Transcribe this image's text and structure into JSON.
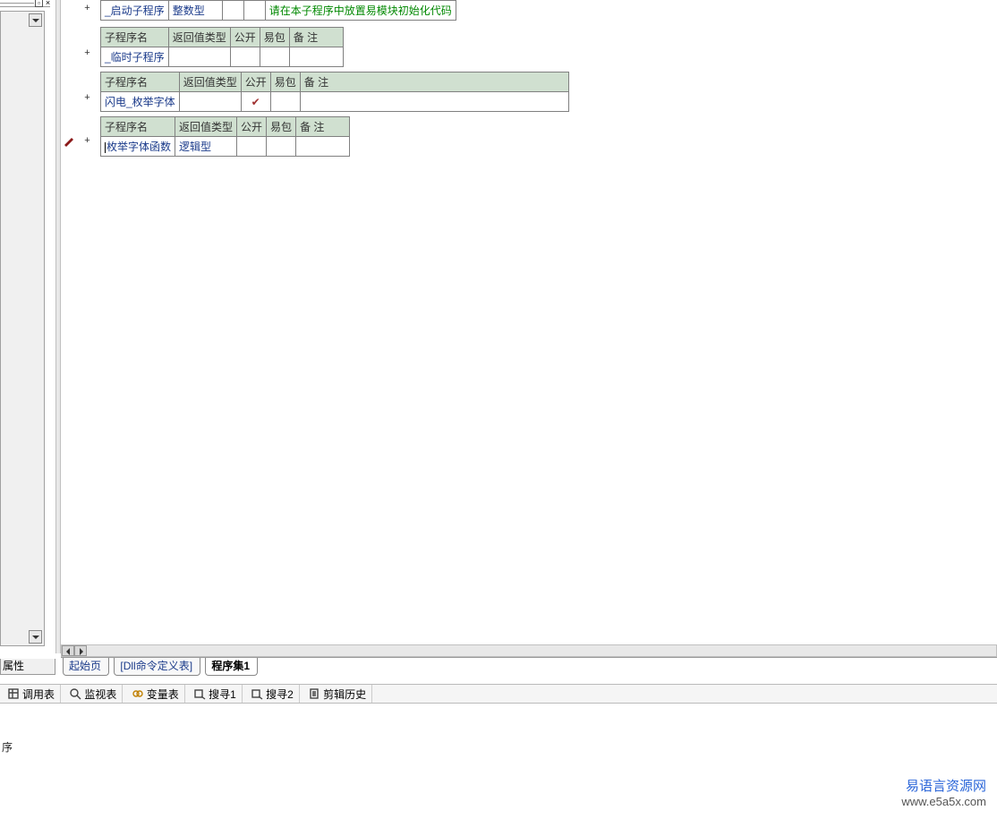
{
  "left_panel": {
    "pin_title": "pin",
    "close_title": "close"
  },
  "tables": {
    "t1": {
      "row": {
        "name": "_启动子程序",
        "ret": "整数型",
        "pub": "",
        "pkg": "",
        "comment": "请在本子程序中放置易模块初始化代码"
      }
    },
    "t2": {
      "head": {
        "c1": "子程序名",
        "c2": "返回值类型",
        "c3": "公开",
        "c4": "易包",
        "c5": "备 注"
      },
      "row": {
        "name": "_临时子程序",
        "ret": "",
        "pub": "",
        "pkg": "",
        "comment": ""
      }
    },
    "t3": {
      "head": {
        "c1": "子程序名",
        "c2": "返回值类型",
        "c3": "公开",
        "c4": "易包",
        "c5": "备 注"
      },
      "row": {
        "name": "闪电_枚举字体",
        "ret": "",
        "pub": "✔",
        "pkg": "",
        "comment": ""
      }
    },
    "t4": {
      "head": {
        "c1": "子程序名",
        "c2": "返回值类型",
        "c3": "公开",
        "c4": "易包",
        "c5": "备 注"
      },
      "row": {
        "name": "枚举字体函数",
        "ret": "逻辑型",
        "pub": "",
        "pkg": "",
        "comment": ""
      }
    }
  },
  "left_bottom_tab": "属性",
  "doc_tabs": {
    "t1": "起始页",
    "t2": "[Dll命令定义表]",
    "t3": "程序集1"
  },
  "toolbar": {
    "i1": "调用表",
    "i2": "监视表",
    "i3": "变量表",
    "i4": "搜寻1",
    "i5": "搜寻2",
    "i6": "剪辑历史"
  },
  "status": "序",
  "watermark": {
    "line1": "易语言资源网",
    "line2": "www.e5a5x.com"
  }
}
